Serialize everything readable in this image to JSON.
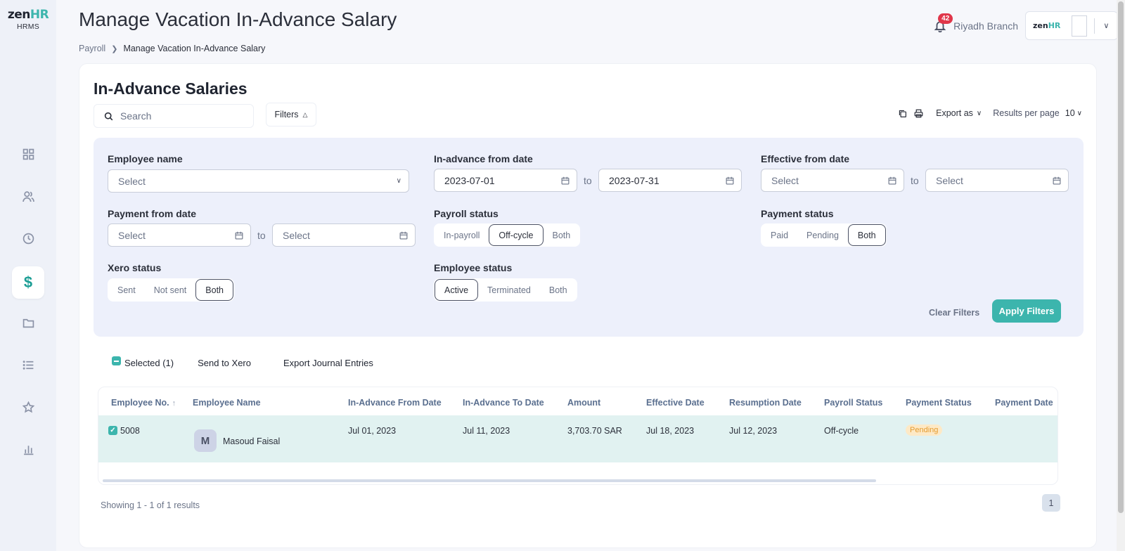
{
  "brand": {
    "logo_main": "zen",
    "logo_accent": "HR",
    "product": "HRMS"
  },
  "sidebar": {
    "items": [
      {
        "icon": "dashboard-icon"
      },
      {
        "icon": "users-icon"
      },
      {
        "icon": "clock-icon"
      },
      {
        "icon": "dollar-icon",
        "active": true,
        "glyph": "$"
      },
      {
        "icon": "folder-icon"
      },
      {
        "icon": "list-icon"
      },
      {
        "icon": "star-icon"
      },
      {
        "icon": "bar-chart-icon"
      }
    ]
  },
  "header": {
    "title": "Manage Vacation In-Advance Salary",
    "breadcrumb": [
      "Payroll",
      "Manage Vacation In-Advance Salary"
    ],
    "notifications": "42",
    "branch": "Riyadh Branch"
  },
  "card": {
    "title": "In-Advance Salaries",
    "search_placeholder": "Search",
    "filters_label": "Filters",
    "export_label": "Export as",
    "results_per_page_label": "Results per page",
    "results_per_page": "10"
  },
  "filters": {
    "employee_name": {
      "label": "Employee name",
      "placeholder": "Select"
    },
    "in_advance_from": {
      "label": "In-advance from date",
      "from": "2023-07-01",
      "to": "2023-07-31"
    },
    "effective_from": {
      "label": "Effective from date",
      "from": "Select",
      "to": "Select"
    },
    "payment_from": {
      "label": "Payment from date",
      "from": "Select",
      "to": "Select"
    },
    "to_word": "to",
    "payroll_status": {
      "label": "Payroll status",
      "options": [
        "In-payroll",
        "Off-cycle",
        "Both"
      ],
      "selected": "Off-cycle"
    },
    "payment_status": {
      "label": "Payment status",
      "options": [
        "Paid",
        "Pending",
        "Both"
      ],
      "selected": "Both"
    },
    "xero_status": {
      "label": "Xero status",
      "options": [
        "Sent",
        "Not sent",
        "Both"
      ],
      "selected": "Both"
    },
    "employee_status": {
      "label": "Employee status",
      "options": [
        "Active",
        "Terminated",
        "Both"
      ],
      "selected": "Active"
    },
    "clear_label": "Clear Filters",
    "apply_label": "Apply Filters"
  },
  "bulk": {
    "selected": "Selected (1)",
    "send_to_xero": "Send to Xero",
    "export_journal": "Export Journal Entries"
  },
  "table": {
    "columns": [
      "Employee No.",
      "Employee Name",
      "In-Advance From Date",
      "In-Advance To Date",
      "Amount",
      "Effective Date",
      "Resumption Date",
      "Payroll Status",
      "Payment Status",
      "Payment Date"
    ],
    "sort_indicator": "↑",
    "rows": [
      {
        "employee_no": "5008",
        "avatar_initial": "M",
        "employee_name": "Masoud Faisal",
        "from_date": "Jul 01, 2023",
        "to_date": "Jul 11, 2023",
        "amount": "3,703.70 SAR",
        "effective_date": "Jul 18, 2023",
        "resumption_date": "Jul 12, 2023",
        "payroll_status": "Off-cycle",
        "payment_status": "Pending",
        "payment_date": ""
      }
    ]
  },
  "pagination": {
    "showing": "Showing 1 - 1 of 1 results",
    "current_page": "1"
  },
  "colors": {
    "accent": "#3cb5ad",
    "panel": "#edf0fb",
    "selected_row": "#e1f2f1",
    "badge": "#e0364a",
    "pending": "#e59b2d"
  }
}
